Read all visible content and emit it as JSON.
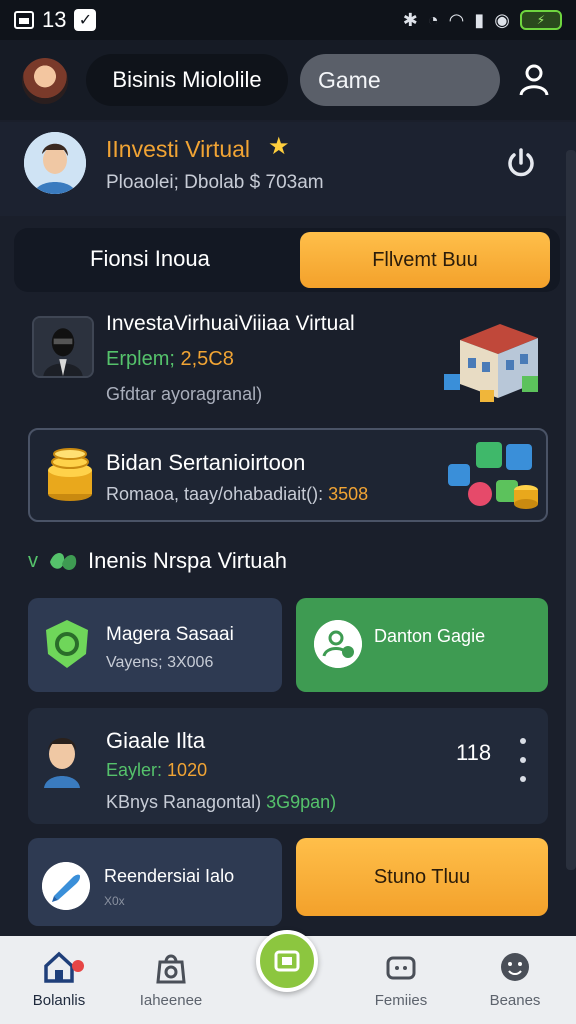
{
  "status_bar": {
    "time": "13",
    "icons": [
      "gallery-icon",
      "check-icon",
      "bluetooth-icon",
      "alarm-icon",
      "wifi-icon",
      "signal-icon",
      "eye-icon",
      "battery-icon"
    ]
  },
  "header": {
    "brand_label": "Bisinis Miololile",
    "search_label": "Game"
  },
  "profile": {
    "title": "IInvesti Virtual",
    "subtitle": "Ploaolei; Dbolab $ 703am"
  },
  "tabs": {
    "left_label": "Fionsi Inoua",
    "right_label": "Fllvemt Buu"
  },
  "invest_card": {
    "title": "InvestaVirhuaiViiiaa Virtual",
    "line2_label": "Erplem;",
    "line2_value": "2,5C8",
    "line3": "Gfdtar ayoragranal)"
  },
  "savings_card": {
    "title": "Bidan Sertanioirtoon",
    "subtitle_prefix": "Romaoa, taay/ohabadiait():",
    "subtitle_value": "3508"
  },
  "section": {
    "title": "Inenis Nrspa Virtuah"
  },
  "tile_a": {
    "title": "Magera Sasaai",
    "subtitle": "Vayens; 3X006"
  },
  "tile_b": {
    "title": "Danton Gagie"
  },
  "user_card": {
    "name": "Giaale Ilta",
    "line2_label": "Eayler:",
    "line2_value": "1020",
    "line3_prefix": "KBnys Ranagontal)",
    "line3_value": "3G9pan)",
    "count": "118"
  },
  "tile_c": {
    "title": "Reendersiai Ialo",
    "subtitle": "X0x"
  },
  "tile_d": {
    "label": "Stuno Tluu"
  },
  "bottom_nav": {
    "items": [
      {
        "label": "Bolanlis",
        "icon": "home-icon"
      },
      {
        "label": "Iaheenee",
        "icon": "bag-icon"
      },
      {
        "label": "Femiies",
        "icon": "gamepad-icon"
      },
      {
        "label": "Beanes",
        "icon": "chat-icon"
      }
    ],
    "center_icon": "trade-icon"
  },
  "colors": {
    "accent_orange": "#f3a12b",
    "accent_green": "#3e9b52",
    "background": "#1a1f2b"
  }
}
